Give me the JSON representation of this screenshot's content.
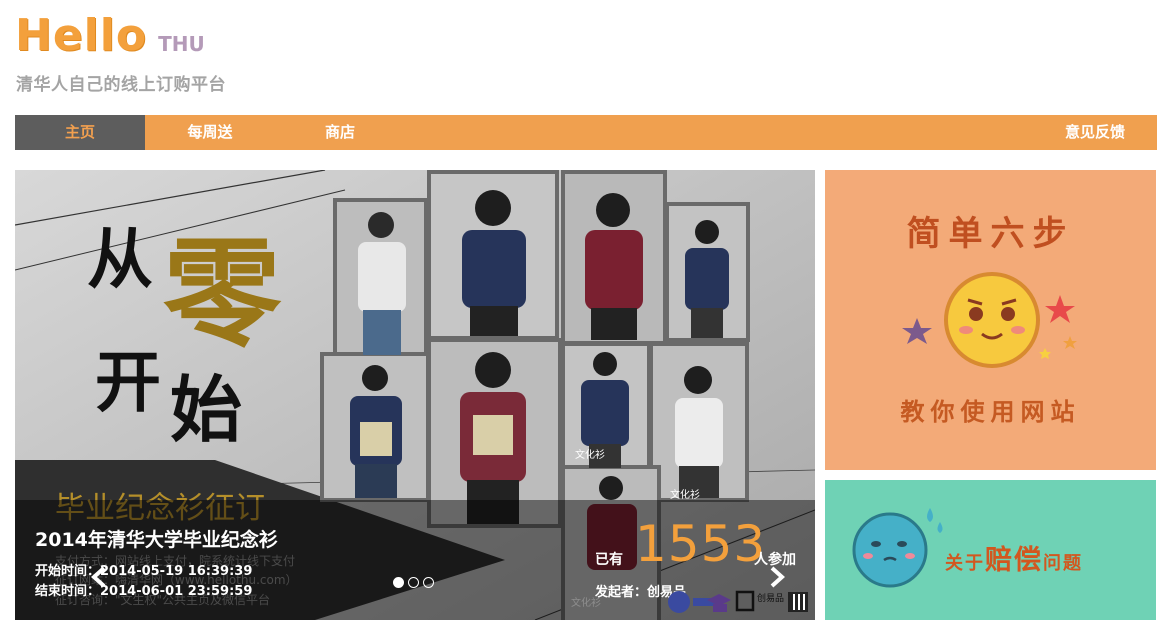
{
  "header": {
    "logo_main": "Hello",
    "logo_sub": "THU",
    "tagline": "清华人自己的线上订购平台"
  },
  "nav": {
    "items": [
      {
        "label": "主页",
        "active": true
      },
      {
        "label": "每周送",
        "active": false
      },
      {
        "label": "商店",
        "active": false
      },
      {
        "label": "意见反馈",
        "active": false
      }
    ]
  },
  "carousel": {
    "slide_art": {
      "big_word_1": "从",
      "big_word_2": "零",
      "big_word_3": "开",
      "big_word_4": "始",
      "banner_title": "毕业纪念衫征订",
      "banner_line1": "支付方式：网站线上支付，院系统计线下支付",
      "banner_line2": "征订网站：嗨清华网（www.hellothu.com）",
      "banner_line3": "征订咨询：\"文生权\"公共主页及微信平台",
      "shirt_tag": "文化衫"
    },
    "caption": {
      "title": "2014年清华大学毕业纪念衫",
      "start_label": "开始时间：",
      "start_time": "2014-05-19 16:39:39",
      "end_label": "结束时间：",
      "end_time": "2014-06-01 23:59:59",
      "already": "已有",
      "count": "1553",
      "join": "人参加",
      "sponsor_label": "发起者：",
      "sponsor": "创易品",
      "brand_small": "创易品"
    },
    "dots": [
      true,
      false,
      false
    ]
  },
  "panels": {
    "steps_title": "简单六步",
    "steps_sub": "教你使用网站",
    "comp_pre": "关于",
    "comp_big": "赔偿",
    "comp_post": "问题"
  },
  "colors": {
    "nav_bg": "#f0a04f",
    "nav_active": "#5d5d5d",
    "accent": "#f3a03c",
    "panel_orange": "#f3aa78",
    "panel_green": "#6fd2b5"
  }
}
